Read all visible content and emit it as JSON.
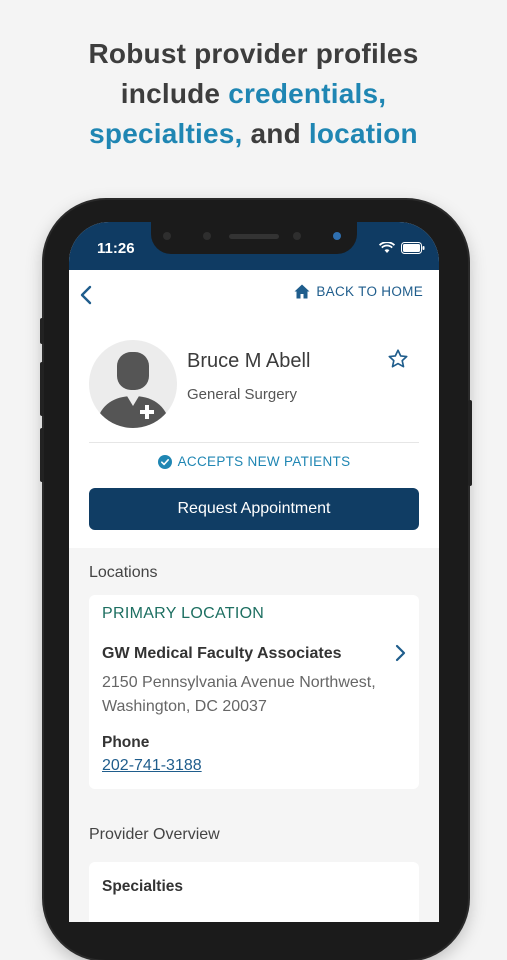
{
  "headline": {
    "line1": "Robust provider profiles",
    "line2_prefix": "include ",
    "line2_highlight": "credentials,",
    "line3_highlight_a": "specialties,",
    "line3_mid": " and ",
    "line3_highlight_b": "location"
  },
  "status_bar": {
    "time": "11:26"
  },
  "nav": {
    "back_icon": "chevron-left-icon",
    "home_label": "BACK TO HOME",
    "home_icon": "home-icon"
  },
  "provider": {
    "name": "Bruce M Abell",
    "specialty": "General Surgery",
    "favorite_icon": "star-outline-icon",
    "accepts_label": "ACCEPTS NEW PATIENTS",
    "request_button": "Request Appointment"
  },
  "locations": {
    "section_title": "Locations",
    "primary_label": "PRIMARY LOCATION",
    "name": "GW Medical Faculty Associates",
    "address_line1": "2150 Pennsylvania Avenue Northwest,",
    "address_line2": "Washington, DC 20037",
    "phone_label": "Phone",
    "phone": "202-741-3188"
  },
  "overview": {
    "section_title": "Provider Overview",
    "specialties_label": "Specialties"
  },
  "colors": {
    "accent": "#1f86b3",
    "primary_dark": "#103d64",
    "status_bar": "#0f3b63",
    "location_green": "#1d6f61"
  }
}
